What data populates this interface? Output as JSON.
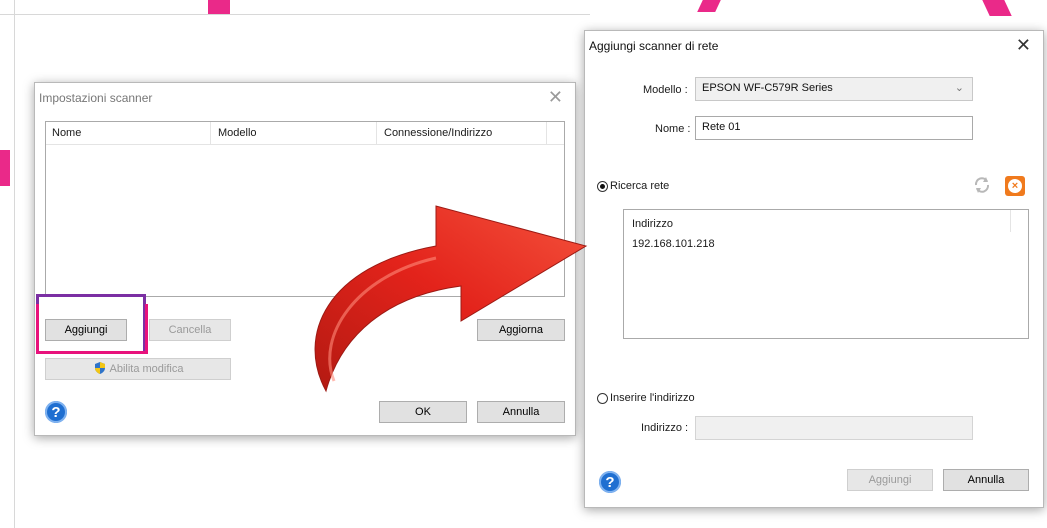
{
  "scanner_settings": {
    "title": "Impostazioni scanner",
    "columns": [
      "Nome",
      "Modello",
      "Connessione/Indirizzo"
    ],
    "buttons": {
      "add": "Aggiungi",
      "delete": "Cancella",
      "update": "Aggiorna",
      "enable_edit": "Abilita modifica",
      "ok": "OK",
      "cancel": "Annulla"
    }
  },
  "add_network_scanner": {
    "title": "Aggiungi scanner di rete",
    "model_label": "Modello :",
    "model_value": "EPSON WF-C579R Series",
    "name_label": "Nome :",
    "name_value": "Rete 01",
    "search_network_label": "Ricerca rete",
    "search_network_selected": true,
    "address_list": {
      "header": "Indirizzo",
      "items": [
        "192.168.101.218"
      ]
    },
    "enter_address_label": "Inserire l'indirizzo",
    "enter_address_selected": false,
    "address_label": "Indirizzo :",
    "address_value": "",
    "buttons": {
      "add": "Aggiungi",
      "cancel": "Annulla"
    }
  },
  "colors": {
    "accent_pink": "#e8127c",
    "highlight_purple": "#7b2fa3",
    "arrow_red": "#e3231b",
    "help_blue": "#1f6fd1",
    "stop_orange": "#f07a1d"
  }
}
